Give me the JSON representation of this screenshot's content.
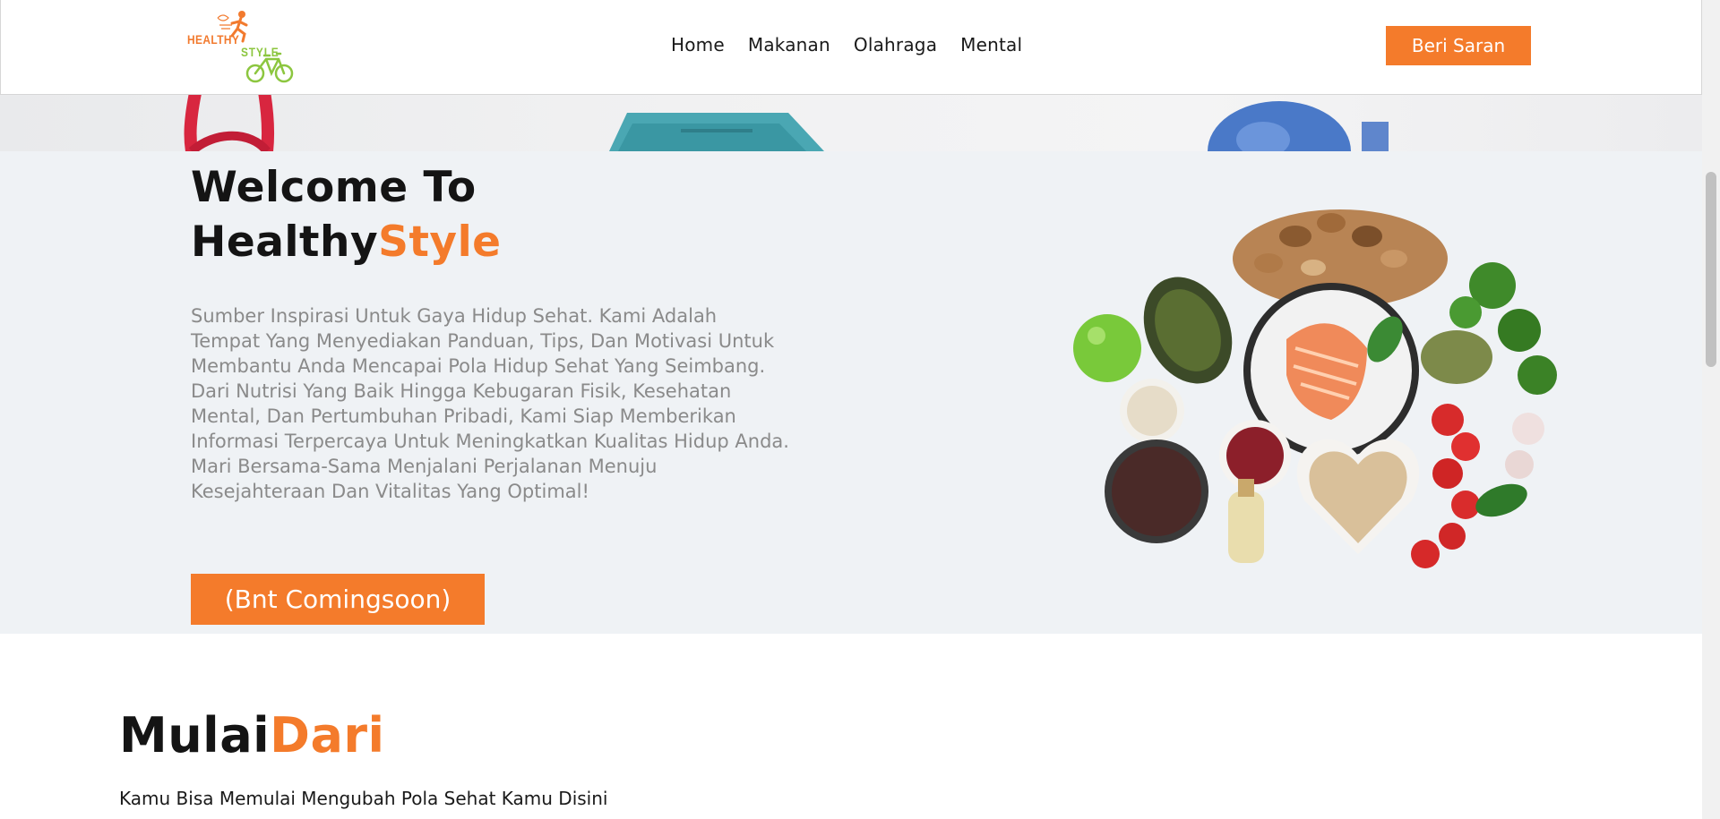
{
  "header": {
    "logo_top": "HEALTHY",
    "logo_bottom": "STYLE",
    "nav": [
      "Home",
      "Makanan",
      "Olahraga",
      "Mental"
    ],
    "cta_label": "Beri Saran"
  },
  "hero": {
    "title_line1": "Welcome To",
    "title_word": "Healthy",
    "title_accent": "Style",
    "description": "Sumber Inspirasi Untuk Gaya Hidup Sehat. Kami Adalah Tempat Yang Menyediakan Panduan, Tips, Dan Motivasi Untuk Membantu Anda Mencapai Pola Hidup Sehat Yang Seimbang. Dari Nutrisi Yang Baik Hingga Kebugaran Fisik, Kesehatan Mental, Dan Pertumbuhan Pribadi, Kami Siap Memberikan Informasi Terpercaya Untuk Meningkatkan Kualitas Hidup Anda. Mari Bersama-Sama Menjalani Perjalanan Menuju Kesejahteraan Dan Vitalitas Yang Optimal!",
    "button_label": "(Bnt Comingsoon)"
  },
  "section": {
    "title_word": "Mulai",
    "title_accent": "Dari",
    "subtitle": "Kamu Bisa Memulai Mengubah Pola Sehat Kamu Disini"
  },
  "colors": {
    "accent": "#f47b2b",
    "logo_green": "#8cc63f",
    "hero_bg": "#eff2f5"
  }
}
